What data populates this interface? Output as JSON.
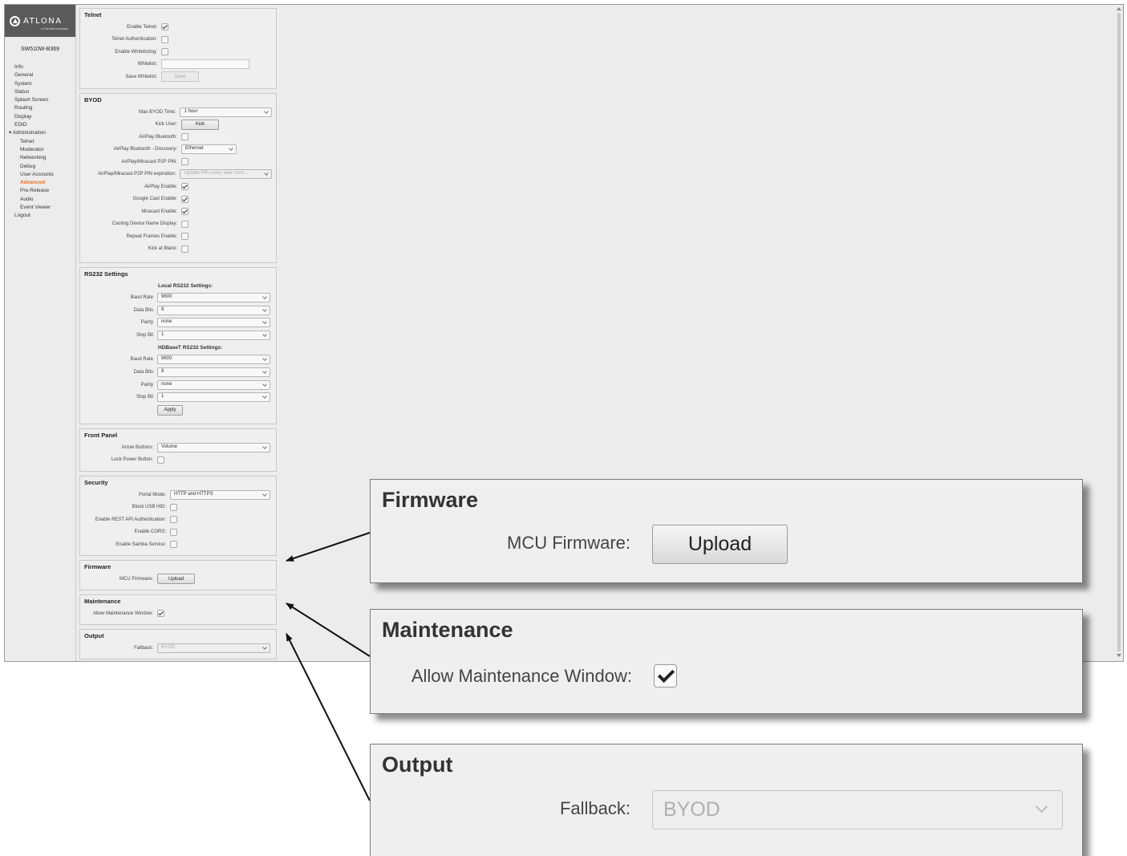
{
  "logo": {
    "brand": "ATLONA",
    "tagline": "a Panduit company"
  },
  "device_name": "SW510W-B369",
  "nav": [
    {
      "label": "Info",
      "level": 0
    },
    {
      "label": "General",
      "level": 0
    },
    {
      "label": "System",
      "level": 0
    },
    {
      "label": "Status",
      "level": 0
    },
    {
      "label": "Splash Screen",
      "level": 0
    },
    {
      "label": "Routing",
      "level": 0
    },
    {
      "label": "Display",
      "level": 0
    },
    {
      "label": "EDID",
      "level": 0
    },
    {
      "label": "Administration",
      "level": 0,
      "expanded": true
    },
    {
      "label": "Telnet",
      "level": 1
    },
    {
      "label": "Moderator",
      "level": 1
    },
    {
      "label": "Networking",
      "level": 1
    },
    {
      "label": "Debug",
      "level": 1
    },
    {
      "label": "User Accounts",
      "level": 1
    },
    {
      "label": "Advanced",
      "level": 1,
      "active": true
    },
    {
      "label": "Pre-Release",
      "level": 1
    },
    {
      "label": "Audio",
      "level": 1
    },
    {
      "label": "Event Viewer",
      "level": 1
    },
    {
      "label": "Logout",
      "level": 0
    }
  ],
  "telnet": {
    "title": "Telnet",
    "enable_telnet": {
      "label": "Enable Telnet:",
      "checked": true
    },
    "telnet_auth": {
      "label": "Telnet Authentication:",
      "checked": false
    },
    "enable_whitelisting": {
      "label": "Enable Whitelisting:",
      "checked": false
    },
    "whitelist": {
      "label": "Whitelist:",
      "value": ""
    },
    "save_whitelist": {
      "label": "Save Whitelist:",
      "button": "Save"
    }
  },
  "byod": {
    "title": "BYOD",
    "max_time": {
      "label": "Max BYOD Time:",
      "value": "1 hour"
    },
    "kick_user": {
      "label": "Kick User:",
      "button": "Kick"
    },
    "airplay_bluetooth": {
      "label": "AirPlay Bluetooth:",
      "checked": false
    },
    "airplay_bt_discovery": {
      "label": "AirPlay Bluetooth - Discovery:",
      "value": "Ethernet"
    },
    "p2p_pin": {
      "label": "AirPlay/Miracast P2P PIN:",
      "checked": false
    },
    "p2p_pin_exp": {
      "label": "AirPlay/Miracast P2P PIN expiration:",
      "value": "Update PIN every new conn..."
    },
    "airplay_enable": {
      "label": "AirPlay Enable:",
      "checked": true
    },
    "google_cast": {
      "label": "Google Cast Enable:",
      "checked": true
    },
    "miracast": {
      "label": "Miracast Enable:",
      "checked": true
    },
    "casting_name": {
      "label": "Casting Device Name Display:",
      "checked": false
    },
    "repeat_frames": {
      "label": "Repeat Frames Enable:",
      "checked": false
    },
    "kick_blank": {
      "label": "Kick at Blank:",
      "checked": false
    }
  },
  "rs232": {
    "title": "RS232 Settings",
    "local_heading": "Local RS232 Settings:",
    "local": {
      "baud": {
        "label": "Baud Rate",
        "value": "9600"
      },
      "data": {
        "label": "Data Bits",
        "value": "8"
      },
      "parity": {
        "label": "Parity",
        "value": "none"
      },
      "stop": {
        "label": "Stop Bit",
        "value": "1"
      }
    },
    "hdbaset_heading": "HDBaseT RS232 Settings:",
    "hdbaset": {
      "baud": {
        "label": "Baud Rate",
        "value": "9600"
      },
      "data": {
        "label": "Data Bits",
        "value": "8"
      },
      "parity": {
        "label": "Parity",
        "value": "none"
      },
      "stop": {
        "label": "Stop Bit",
        "value": "1"
      }
    },
    "apply_button": "Apply"
  },
  "front_panel": {
    "title": "Front Panel",
    "arrow_buttons": {
      "label": "Arrow Buttons:",
      "value": "Volume"
    },
    "lock_power": {
      "label": "Lock Power Button:",
      "checked": false
    }
  },
  "security": {
    "title": "Security",
    "portal_mode": {
      "label": "Portal Mode:",
      "value": "HTTP and HTTPS"
    },
    "block_usb": {
      "label": "Block USB HID:",
      "checked": false
    },
    "rest_api": {
      "label": "Enable REST API Authentication:",
      "checked": false
    },
    "cors": {
      "label": "Enable CORS:",
      "checked": false
    },
    "samba": {
      "label": "Enable Samba Service:",
      "checked": false
    }
  },
  "firmware": {
    "title": "Firmware",
    "mcu": {
      "label": "MCU Firmware:",
      "button": "Upload"
    }
  },
  "maintenance": {
    "title": "Maintenance",
    "allow_window": {
      "label": "Allow Maintenance Window:",
      "checked": true
    }
  },
  "output": {
    "title": "Output",
    "fallback": {
      "label": "Fallback:",
      "value": "BYOD",
      "disabled": true
    }
  },
  "colors": {
    "active_nav": "#e86c1e",
    "logo_bg": "#5a5a5a",
    "panel_bg": "#efefef"
  }
}
